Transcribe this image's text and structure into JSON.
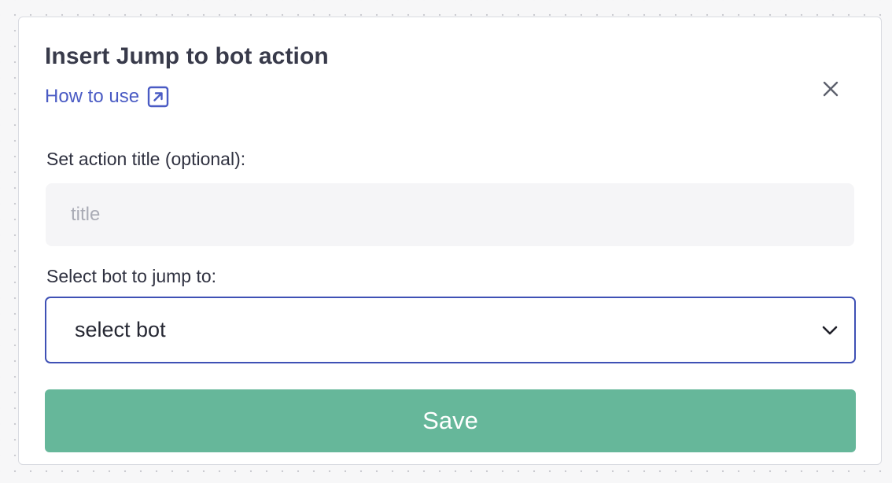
{
  "modal": {
    "title": "Insert Jump to bot action",
    "help_link": {
      "label": "How to use",
      "icon": "external-link-icon"
    },
    "close_icon": "close-icon"
  },
  "form": {
    "title_field": {
      "label": "Set action title (optional):",
      "placeholder": "title",
      "value": ""
    },
    "bot_field": {
      "label": "Select bot to jump to:",
      "selected": "select bot",
      "icon": "chevron-down-icon"
    },
    "save_label": "Save"
  },
  "colors": {
    "accent": "#3f51b5",
    "link": "#4a5bc4",
    "save_button": "#66b79a",
    "title_text": "#383a4a"
  }
}
